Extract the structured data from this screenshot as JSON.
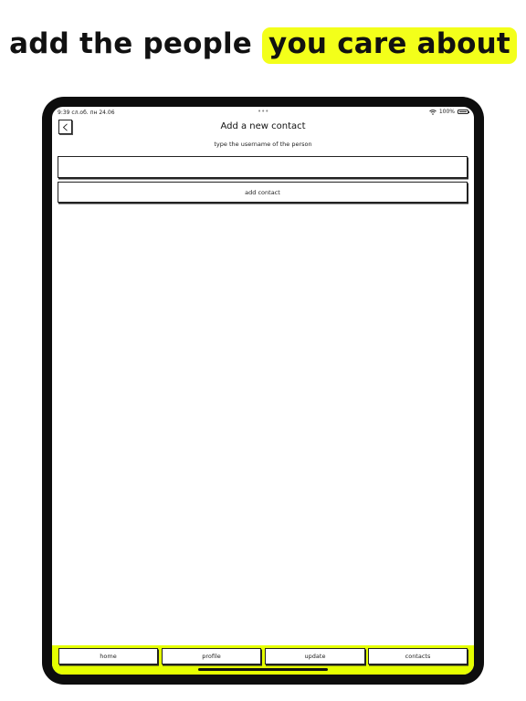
{
  "headline": {
    "prefix": "add the people",
    "highlight": "you care about"
  },
  "statusbar": {
    "time": "9:39 сл.об.  пн 24.06",
    "dots": "•••",
    "battery": "100%"
  },
  "screen": {
    "title": "Add a new contact",
    "subtitle": "type the username of the person",
    "input": {
      "value": "",
      "placeholder": ""
    },
    "add_button": "add contact"
  },
  "nav": {
    "items": [
      {
        "label": "home"
      },
      {
        "label": "profile"
      },
      {
        "label": "update"
      },
      {
        "label": "contacts"
      }
    ]
  },
  "colors": {
    "accent": "#e5ff00",
    "headline_highlight": "#f3ff1a",
    "device_frame": "#0d0d0d"
  },
  "icons": {
    "back": "chevron-left-icon",
    "wifi": "wifi-icon",
    "battery": "battery-icon"
  }
}
